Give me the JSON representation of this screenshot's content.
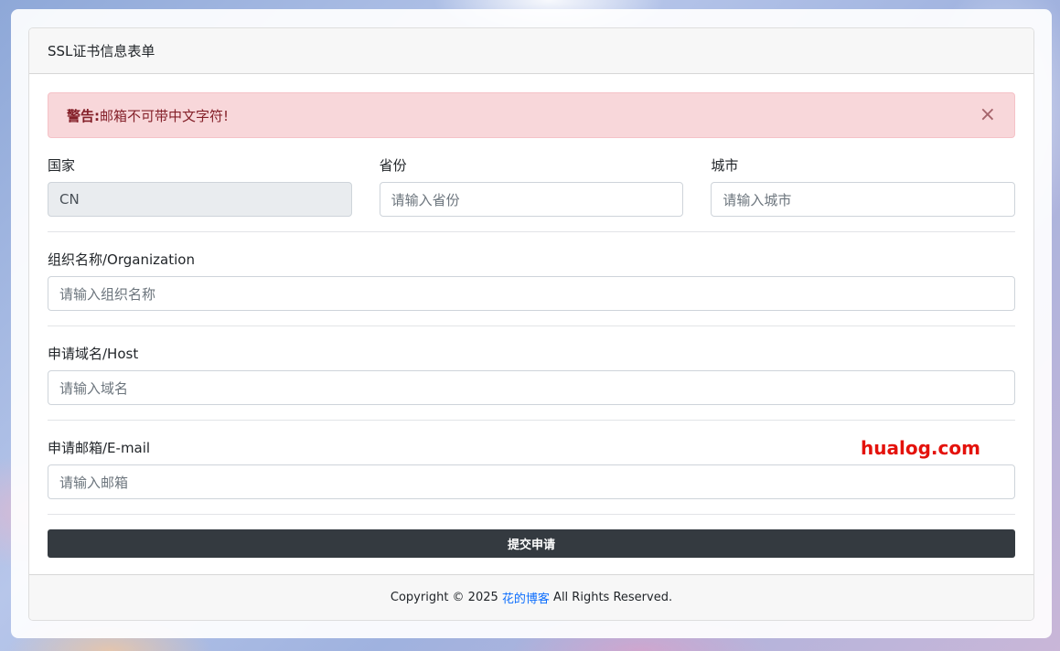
{
  "card": {
    "title": "SSL证书信息表单"
  },
  "alert": {
    "strong": "警告:",
    "message": "邮箱不可带中文字符!",
    "close_symbol": "×"
  },
  "fields": {
    "country": {
      "label": "国家",
      "value": "CN"
    },
    "province": {
      "label": "省份",
      "placeholder": "请输入省份"
    },
    "city": {
      "label": "城市",
      "placeholder": "请输入城市"
    },
    "organization": {
      "label": "组织名称/Organization",
      "placeholder": "请输入组织名称"
    },
    "host": {
      "label": "申请域名/Host",
      "placeholder": "请输入域名"
    },
    "email": {
      "label": "申请邮箱/E-mail",
      "placeholder": "请输入邮箱"
    }
  },
  "submit": {
    "label": "提交申请"
  },
  "footer": {
    "prefix": "Copyright © 2025 ",
    "link": "花的博客",
    "suffix": " All Rights Reserved."
  },
  "watermark": {
    "text": "hualog.com"
  },
  "colors": {
    "alert_bg": "#f8d7da",
    "alert_text": "#842029",
    "button_bg": "#343a40",
    "link": "#0d6efd",
    "watermark": "#e4120c"
  }
}
